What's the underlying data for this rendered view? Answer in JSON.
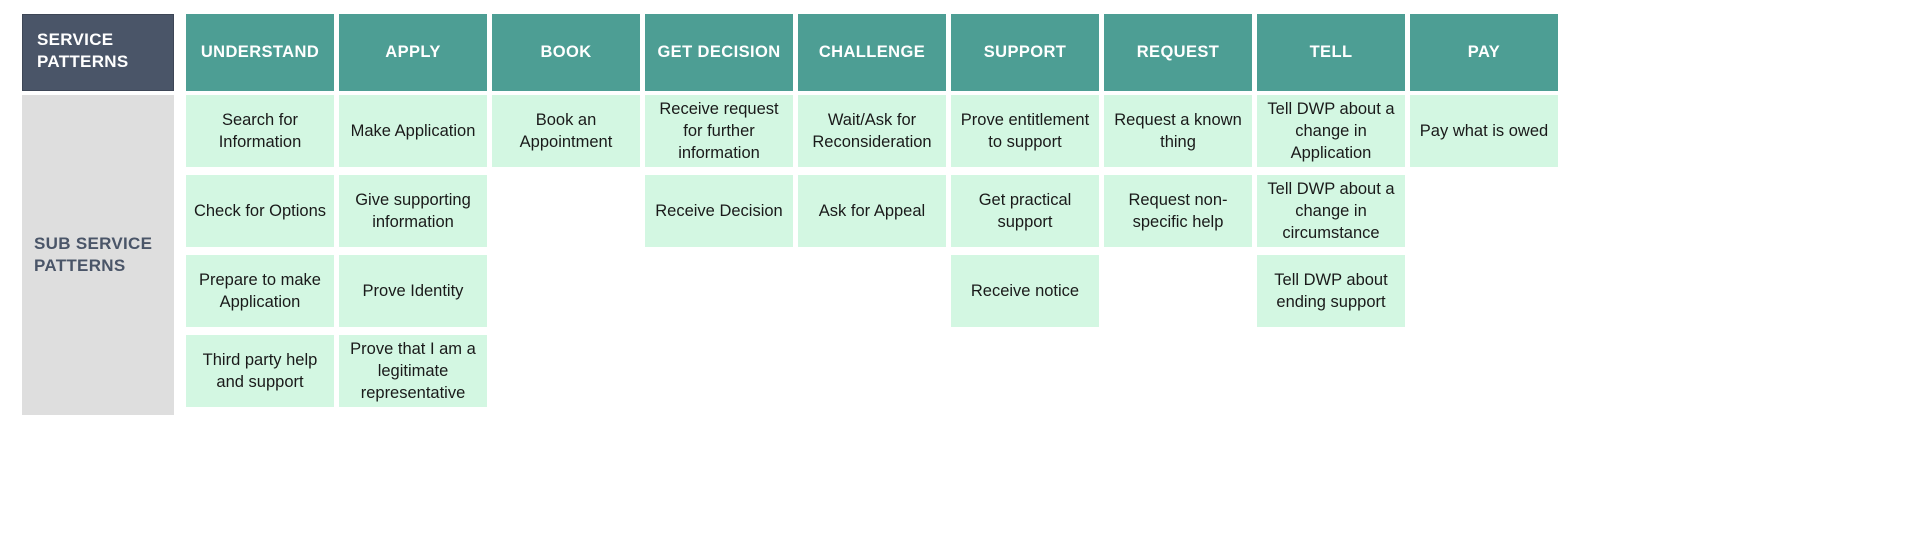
{
  "left_column": {
    "service_patterns_label": "SERVICE PATTERNS",
    "sub_service_patterns_label": "SUB SERVICE PATTERNS"
  },
  "colors": {
    "header_dark": "#4a5568",
    "header_teal": "#4d9e94",
    "cell_mint": "#d3f7e2",
    "sidebar_grey": "#dedede",
    "page_background": "#ffffff",
    "cell_text": "#1a1a1a",
    "header_text": "#ffffff"
  },
  "chart_data": {
    "type": "table",
    "title": "Service Patterns / Sub Service Patterns matrix",
    "row_label_header": "SERVICE PATTERNS",
    "row_label_body": "SUB SERVICE PATTERNS",
    "columns": [
      "UNDERSTAND",
      "APPLY",
      "BOOK",
      "GET DECISION",
      "CHALLENGE",
      "SUPPORT",
      "REQUEST",
      "TELL",
      "PAY"
    ],
    "max_rows": 4,
    "cells": [
      [
        "Search for Information",
        "Check for Options",
        "Prepare to make Application",
        "Third party help and support"
      ],
      [
        "Make Application",
        "Give supporting information",
        "Prove Identity",
        "Prove that I am a legitimate representative"
      ],
      [
        "Book an Appointment",
        "",
        "",
        ""
      ],
      [
        "Receive request for further information",
        "Receive Decision",
        "",
        ""
      ],
      [
        "Wait/Ask for Reconsideration",
        "Ask for Appeal",
        "",
        ""
      ],
      [
        "Prove entitlement to support",
        "Get practical support",
        "Receive notice",
        ""
      ],
      [
        "Request a known thing",
        "Request non-specific help",
        "",
        ""
      ],
      [
        "Tell DWP about a change in Application",
        "Tell DWP about a change in circumstance",
        "Tell DWP about ending support",
        ""
      ],
      [
        "Pay what is owed",
        "",
        "",
        ""
      ]
    ]
  }
}
